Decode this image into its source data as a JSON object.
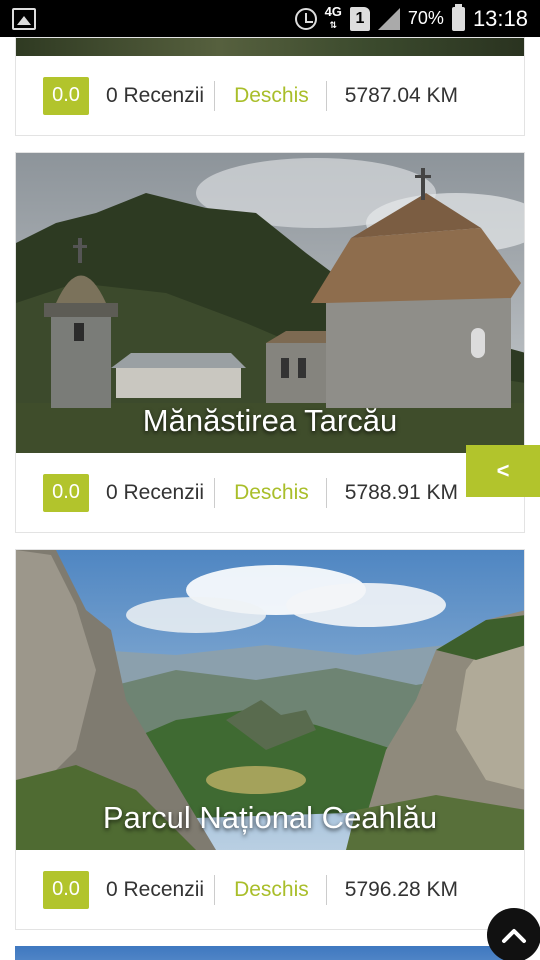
{
  "status_bar": {
    "icons": [
      "image-icon",
      "alarm-icon",
      "network-4g-icon",
      "sim-1-icon",
      "signal-icon",
      "battery-icon"
    ],
    "network": "4G",
    "sim": "1",
    "battery": "70%",
    "time": "13:18"
  },
  "listings": [
    {
      "title": "",
      "rating": "0.0",
      "reviews": "0 Recenzii",
      "status": "Deschis",
      "distance": "5787.04 KM"
    },
    {
      "title": "Mănăstirea Tarcău",
      "rating": "0.0",
      "reviews": "0 Recenzii",
      "status": "Deschis",
      "distance": "5788.91 KM"
    },
    {
      "title": "Parcul Național Ceahlău",
      "rating": "0.0",
      "reviews": "0 Recenzii",
      "status": "Deschis",
      "distance": "5796.28 KM"
    }
  ],
  "side_tab": {
    "label": "<"
  },
  "colors": {
    "accent": "#b2c42c",
    "open_text": "#a9be2a",
    "status_bar": "#000000"
  }
}
